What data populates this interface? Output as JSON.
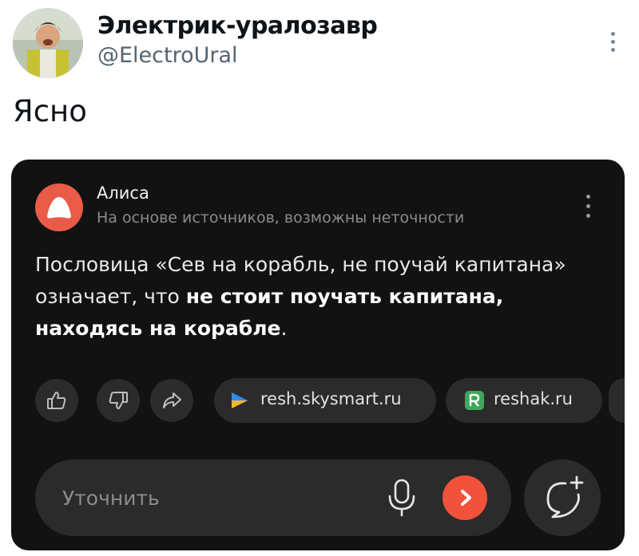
{
  "tweet": {
    "display_name": "Электрик-уралозавр",
    "handle": "@ElectroUral",
    "text": "Ясно",
    "avatar_icon": "person-photo-avatar",
    "menu_icon": "more-vertical-icon"
  },
  "card": {
    "assistant_name": "Алиса",
    "disclaimer": "На основе источников, возможны неточности",
    "answer": {
      "part1": "Пословица «Сев на корабль, не поучай капитана» означает, что ",
      "bold": "не стоит поучать капитана, находясь на корабле",
      "part2": "."
    },
    "actions": [
      {
        "icon": "thumbs-up-icon"
      },
      {
        "icon": "thumbs-down-icon"
      },
      {
        "icon": "share-icon"
      }
    ],
    "sources": [
      {
        "label": "resh.skysmart.ru",
        "icon": "skysmart-logo-icon"
      },
      {
        "label": "reshak.ru",
        "icon": "reshak-logo-icon"
      }
    ],
    "input_placeholder": "Уточнить",
    "colors": {
      "background": "#121212",
      "accent": "#f2523c",
      "surface": "#2b2b2b"
    }
  }
}
